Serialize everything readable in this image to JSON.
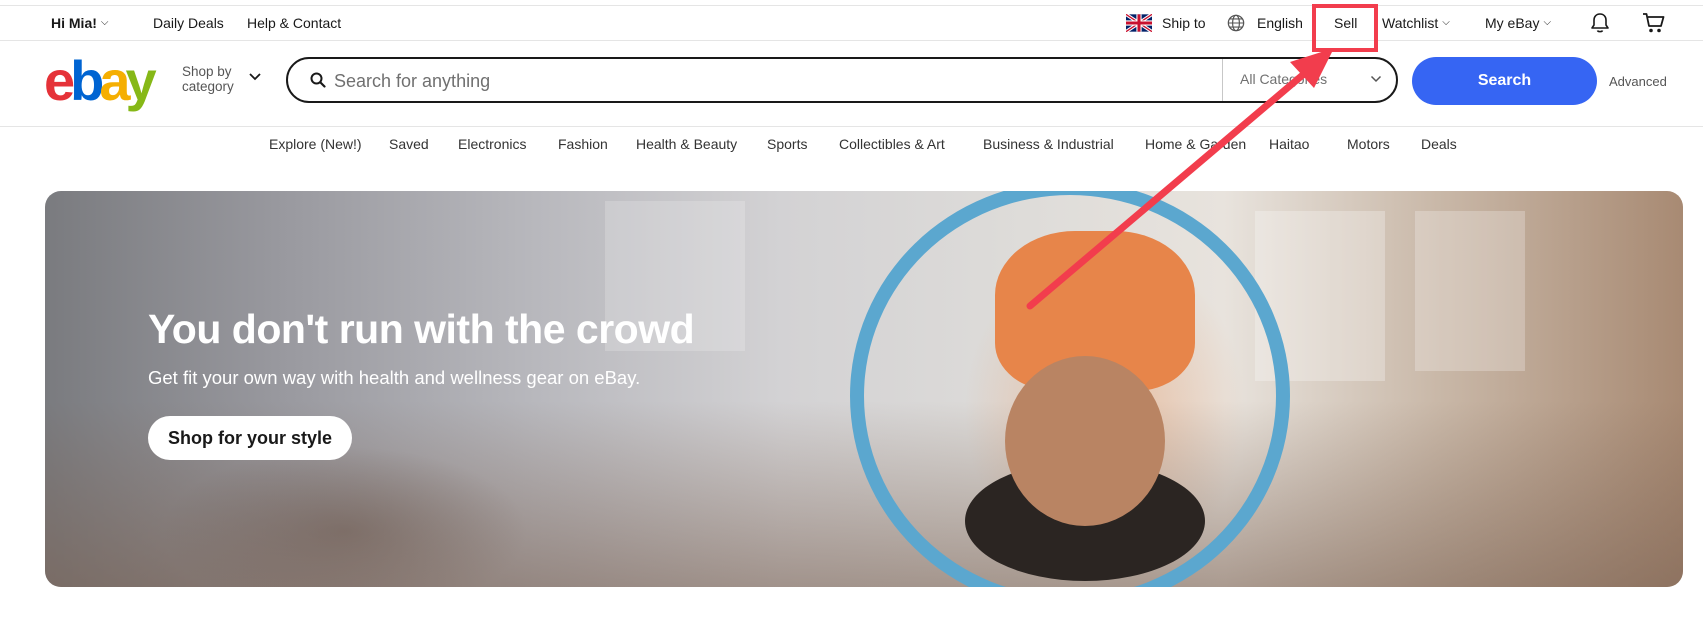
{
  "topbar": {
    "greeting": "Hi Mia!",
    "daily_deals": "Daily Deals",
    "help_contact": "Help & Contact",
    "ship_to": "Ship to",
    "language": "English",
    "sell": "Sell",
    "watchlist": "Watchlist",
    "my_ebay": "My eBay"
  },
  "header": {
    "logo_letters": [
      "e",
      "b",
      "a",
      "y"
    ],
    "logo_colors": [
      "#e53238",
      "#0064d2",
      "#f5af02",
      "#86b817"
    ],
    "shop_by_line1": "Shop by",
    "shop_by_line2": "category",
    "search_placeholder": "Search for anything",
    "category_select": "All Categories",
    "search_button": "Search",
    "advanced": "Advanced"
  },
  "nav": {
    "items": [
      "Explore (New!)",
      "Saved",
      "Electronics",
      "Fashion",
      "Health & Beauty",
      "Sports",
      "Collectibles & Art",
      "Business & Industrial",
      "Home & Garden",
      "Haitao",
      "Motors",
      "Deals"
    ]
  },
  "hero": {
    "title": "You don't run with the crowd",
    "subtitle": "Get fit your own way with health and wellness gear on eBay.",
    "cta": "Shop for your style"
  },
  "colors": {
    "accent": "#3665f3",
    "annotation": "#f23d4d"
  }
}
